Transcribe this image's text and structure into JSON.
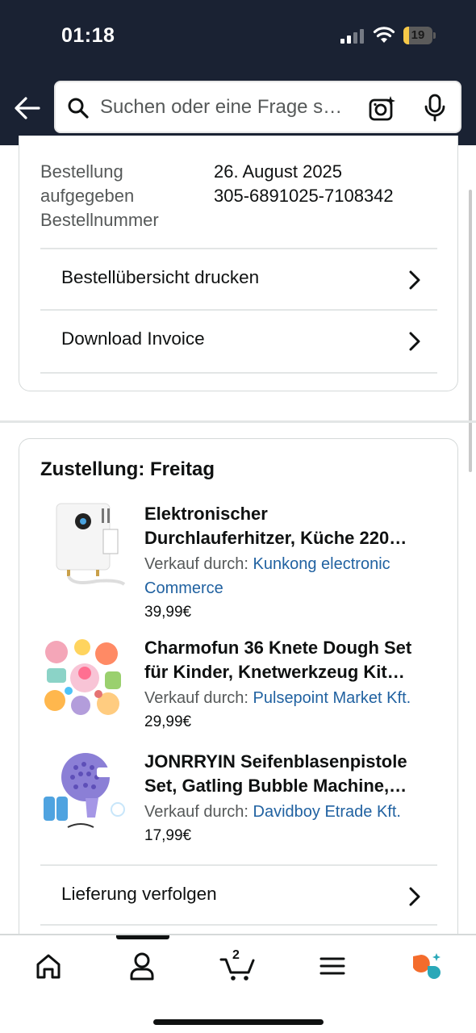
{
  "status_bar": {
    "time": "01:18",
    "battery": "19",
    "battery_level": 0.19
  },
  "header": {
    "search_placeholder": "Suchen oder eine Frage s…"
  },
  "order": {
    "label_line1": "Bestellung",
    "label_line2": "aufgegeben",
    "label_line3": "Bestellnummer",
    "date": "26. August 2025",
    "number": "305-6891025-7108342",
    "links": [
      "Bestellübersicht drucken",
      "Download Invoice"
    ]
  },
  "delivery": {
    "title": "Zustellung: Freitag",
    "sold_by_label": "Verkauf durch: ",
    "items": [
      {
        "title_line1": "Elektronischer",
        "title_line2": "Durchlauferhitzer, Küche 220…",
        "seller_line1": "Kunkong electronic",
        "seller_line2": "Commerce",
        "price": "39,99€"
      },
      {
        "title_line1": "Charmofun 36 Knete Dough Set",
        "title_line2": "für Kinder, Knetwerkzeug Kit…",
        "seller": "Pulsepoint Market Kft.",
        "price": "29,99€"
      },
      {
        "title_line1": "JONRRYIN Seifenblasenpistole",
        "title_line2": "Set, Gatling Bubble Machine,…",
        "seller": "Davidboy Etrade Kft.",
        "price": "17,99€"
      }
    ],
    "track_label": "Lieferung verfolgen"
  },
  "bottom_nav": {
    "cart_count": "2"
  },
  "colors": {
    "header_bg": "#1a2233",
    "link_blue": "#2162a1",
    "rufus_orange": "#f46c2c",
    "rufus_teal": "#2aa8b8"
  }
}
